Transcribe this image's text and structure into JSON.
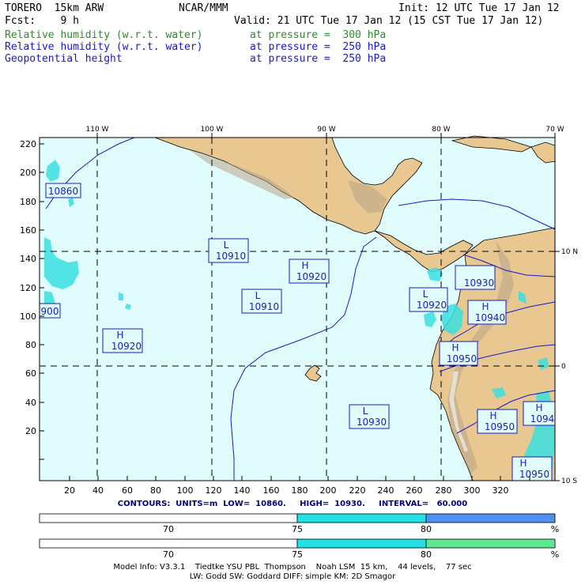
{
  "header": {
    "model": "TORERO  15km ARW",
    "center": "NCAR/MMM",
    "init": "Init: 12 UTC Tue 17 Jan 12",
    "fcst": "Fcst:    9 h",
    "valid": "Valid: 21 UTC Tue 17 Jan 12 (15 CST Tue 17 Jan 12)",
    "fields": [
      {
        "name": "Relative humidity (w.r.t. water)",
        "level": "at pressure =  300 hPa",
        "color": "#2e8b2e"
      },
      {
        "name": "Relative humidity (w.r.t. water)",
        "level": "at pressure =  250 hPa",
        "color": "#1a1ac8"
      },
      {
        "name": "Geopotential height",
        "level": "at pressure =  250 hPa",
        "color": "#1a1ac8"
      }
    ]
  },
  "map": {
    "top_lon_labels": [
      "110 W",
      "100 W",
      "90 W",
      "80 W",
      "70 W"
    ],
    "right_lat_labels": [
      "10 N",
      "0",
      "10 S"
    ],
    "left_ticks": [
      "220",
      "200",
      "180",
      "160",
      "140",
      "120",
      "100",
      "80",
      "60",
      "40",
      "20"
    ],
    "bottom_ticks": [
      "20",
      "40",
      "60",
      "80",
      "100",
      "120",
      "140",
      "160",
      "180",
      "200",
      "220",
      "240",
      "260",
      "280",
      "300",
      "320"
    ],
    "ocean_color": "#e0fcfc",
    "land_color": "#e8c890",
    "contour_color": "#1a1ac8",
    "height_labels": [
      {
        "type": "",
        "value": "10860"
      },
      {
        "type": "",
        "value": "900"
      },
      {
        "type": "L",
        "value": "10910"
      },
      {
        "type": "H",
        "value": "10920"
      },
      {
        "type": "L",
        "value": "10910"
      },
      {
        "type": "H",
        "value": "10920"
      },
      {
        "type": "L",
        "value": "10920"
      },
      {
        "type": "",
        "value": "10930"
      },
      {
        "type": "H",
        "value": "10940"
      },
      {
        "type": "H",
        "value": "10950"
      },
      {
        "type": "L",
        "value": "10930"
      },
      {
        "type": "H",
        "value": "10950"
      },
      {
        "type": "H",
        "value": "1094"
      },
      {
        "type": "H",
        "value": "10950"
      }
    ]
  },
  "contours": {
    "text": "CONTOURS:  UNITS=m  LOW=  10860.     HIGH=  10930.     INTERVAL=   60.000"
  },
  "colorbars": [
    {
      "ticks": [
        "70",
        "75",
        "80"
      ],
      "unit": "%",
      "colors": [
        "#ffffff",
        "#20e0e8",
        "#5090f0"
      ]
    },
    {
      "ticks": [
        "70",
        "75",
        "80"
      ],
      "unit": "%",
      "colors": [
        "#ffffff",
        "#20e0e8",
        "#60e890"
      ]
    }
  ],
  "footer": {
    "line1": "Model Info: V3.3.1    Tiedtke YSU PBL  Thompson    Noah LSM  15 km,    44 levels,    77 sec",
    "line2": "LW: Godd SW: Goddard DIFF: simple KM: 2D Smagor"
  }
}
